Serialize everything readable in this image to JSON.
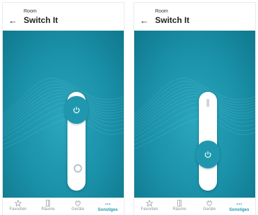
{
  "screens": [
    {
      "state": "on",
      "header": {
        "subtitle": "Room",
        "title": "Switch It"
      },
      "nav": {
        "items": [
          {
            "label": "Favoriten",
            "icon": "star-icon",
            "active": false
          },
          {
            "label": "Räume",
            "icon": "door-icon",
            "active": false
          },
          {
            "label": "Geräte",
            "icon": "plug-icon",
            "active": false
          },
          {
            "label": "Sonstiges",
            "icon": "more-icon",
            "active": true
          }
        ]
      }
    },
    {
      "state": "off",
      "header": {
        "subtitle": "Room",
        "title": "Switch It"
      },
      "nav": {
        "items": [
          {
            "label": "Favoriten",
            "icon": "star-icon",
            "active": false
          },
          {
            "label": "Räume",
            "icon": "door-icon",
            "active": false
          },
          {
            "label": "Geräte",
            "icon": "plug-icon",
            "active": false
          },
          {
            "label": "Sonstiges",
            "icon": "more-icon",
            "active": true
          }
        ]
      }
    }
  ],
  "colors": {
    "accent": "#1f98af",
    "background": "#1a91a8",
    "nav_inactive": "#8b959b"
  },
  "icons": {
    "back": "arrow-left-icon",
    "power": "power-icon",
    "expand": "chevron-up-icon",
    "more_glyph": "..."
  }
}
